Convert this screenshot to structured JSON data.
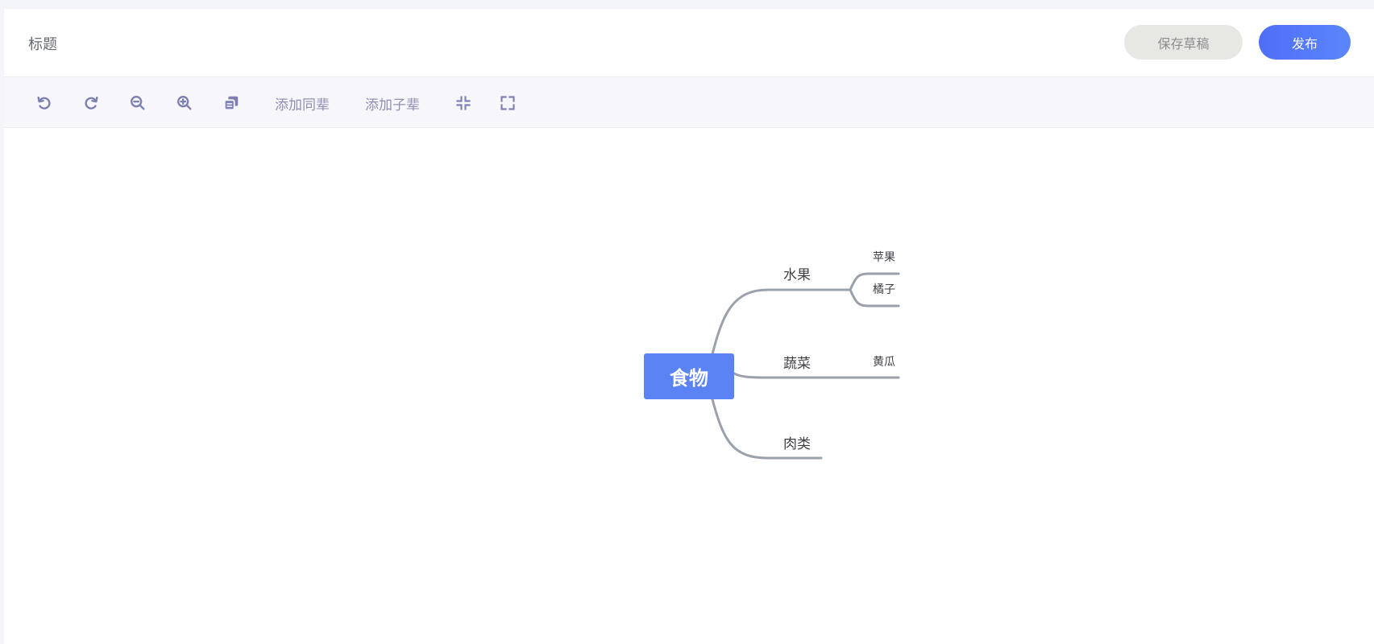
{
  "header": {
    "title": "标题",
    "save_draft_label": "保存草稿",
    "publish_label": "发布"
  },
  "toolbar": {
    "icons": [
      "undo-icon",
      "redo-icon",
      "zoom-out-icon",
      "zoom-in-icon",
      "copy-icon",
      "collapse-icon",
      "fullscreen-icon"
    ],
    "add_sibling_label": "添加同辈",
    "add_child_label": "添加子辈"
  },
  "mindmap": {
    "root": "食物",
    "branches": [
      {
        "label": "水果",
        "children": [
          "苹果",
          "橘子"
        ]
      },
      {
        "label": "蔬菜",
        "children": [
          "黄瓜"
        ]
      },
      {
        "label": "肉类",
        "children": []
      }
    ]
  },
  "colors": {
    "accent": "#5b83f4",
    "publish_button": "#4f6ef8",
    "draft_button": "#e7e8e3",
    "toolbar_icon": "#7e80b3",
    "edge": "#9aa1ab"
  }
}
